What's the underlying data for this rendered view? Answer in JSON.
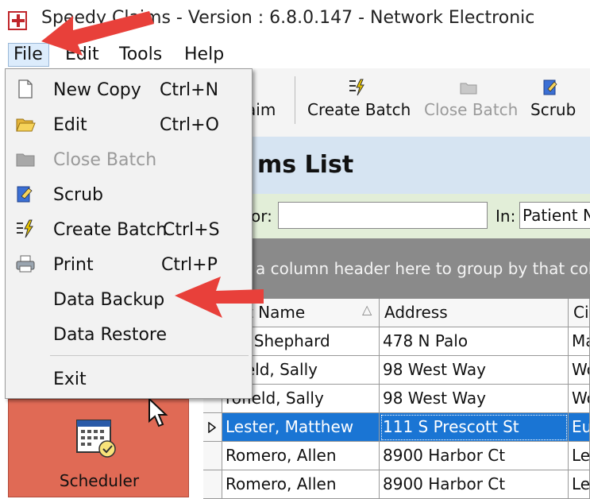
{
  "window": {
    "title": "Speedy Claims - Version : 6.8.0.147 - Network Electronic"
  },
  "menubar": {
    "file": "File",
    "edit": "Edit",
    "tools": "Tools",
    "help": "Help"
  },
  "file_menu": {
    "items": [
      {
        "label": "New Copy",
        "shortcut": "Ctrl+N",
        "icon": "document-icon",
        "enabled": true
      },
      {
        "label": "Edit",
        "shortcut": "Ctrl+O",
        "icon": "folder-open-icon",
        "enabled": true
      },
      {
        "label": "Close Batch",
        "shortcut": "",
        "icon": "folder-closed-icon",
        "enabled": false
      },
      {
        "label": "Scrub",
        "shortcut": "",
        "icon": "scrub-icon",
        "enabled": true
      },
      {
        "label": "Create Batch",
        "shortcut": "Ctrl+S",
        "icon": "lightning-list-icon",
        "enabled": true
      },
      {
        "label": "Print",
        "shortcut": "Ctrl+P",
        "icon": "printer-icon",
        "enabled": true
      },
      {
        "label": "Data Backup",
        "shortcut": "",
        "icon": "",
        "enabled": true
      },
      {
        "label": "Data Restore",
        "shortcut": "",
        "icon": "",
        "enabled": true
      },
      {
        "label": "Exit",
        "shortcut": "",
        "icon": "",
        "enabled": true
      }
    ]
  },
  "toolbar": {
    "claim": "aim",
    "create_batch": "Create Batch",
    "close_batch": "Close Batch",
    "scrub": "Scrub"
  },
  "header": {
    "title": "ms List"
  },
  "search": {
    "label": "or:",
    "value": "",
    "in_label": "In:",
    "in_value": "Patient N"
  },
  "group_hint": "a column header here to group by that colu",
  "grid": {
    "columns": [
      "ent Name",
      "Address",
      "Cit"
    ],
    "rows": [
      [
        "ns, Shephard",
        "478 N Palo",
        "Ma"
      ],
      [
        "ofield, Sally",
        "98 West Way",
        "Wo"
      ],
      [
        "rofield, Sally",
        "98 West Way",
        "Wo"
      ],
      [
        "Lester, Matthew",
        "111 S Prescott St",
        "Eu"
      ],
      [
        "Romero, Allen",
        "8900 Harbor Ct",
        "Le"
      ],
      [
        "Romero, Allen",
        "8900 Harbor Ct",
        "Le"
      ]
    ],
    "selected_row": 3
  },
  "sidebar": {
    "scheduler": "Scheduler"
  },
  "colors": {
    "arrow": "#e8403a",
    "selection": "#1a75d4",
    "scheduler_bg": "#e06a55",
    "header_bg": "#d6e4f2",
    "search_bg": "#e2eed8"
  }
}
